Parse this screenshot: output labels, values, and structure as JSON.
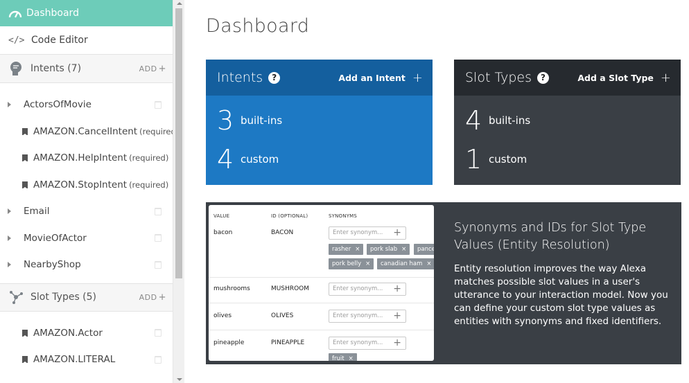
{
  "sidebar": {
    "dashboard_label": "Dashboard",
    "code_editor_label": "Code Editor",
    "intents_header": "Intents (7)",
    "intents_add": "ADD",
    "intents": [
      {
        "label": "ActorsOfMovie",
        "kind": "top"
      },
      {
        "label": "AMAZON.CancelIntent",
        "note": "(required)",
        "kind": "sub"
      },
      {
        "label": "AMAZON.HelpIntent",
        "note": "(required)",
        "kind": "sub"
      },
      {
        "label": "AMAZON.StopIntent",
        "note": "(required)",
        "kind": "sub"
      },
      {
        "label": "Email",
        "kind": "top"
      },
      {
        "label": "MovieOfActor",
        "kind": "top"
      },
      {
        "label": "NearbyShop",
        "kind": "top"
      }
    ],
    "slot_types_header": "Slot Types (5)",
    "slot_types_add": "ADD",
    "slot_types": [
      {
        "label": "AMAZON.Actor"
      },
      {
        "label": "AMAZON.LITERAL"
      }
    ]
  },
  "main": {
    "title": "Dashboard",
    "intents_card": {
      "title": "Intents",
      "action": "Add an Intent",
      "builtins_count": "3",
      "builtins_label": "built-ins",
      "custom_count": "4",
      "custom_label": "custom"
    },
    "slots_card": {
      "title": "Slot Types",
      "action": "Add a Slot Type",
      "builtins_count": "4",
      "builtins_label": "built-ins",
      "custom_count": "1",
      "custom_label": "custom"
    },
    "promo": {
      "title": "Synonyms and IDs for Slot Type Values (Entity Resolution)",
      "body": "Entity resolution improves the way Alexa matches possible slot values in a user's utterance to your interaction model. Now you can define your custom slot type values as entities with synonyms and fixed identifiers.",
      "table": {
        "headers": [
          "VALUE",
          "ID (OPTIONAL)",
          "SYNONYMS"
        ],
        "placeholder": "Enter synonym...",
        "rows": [
          {
            "value": "bacon",
            "id": "BACON",
            "synonyms": [
              "rasher",
              "pork slab",
              "pancet",
              "pork belly",
              "canadian ham"
            ]
          },
          {
            "value": "mushrooms",
            "id": "MUSHROOM",
            "synonyms": []
          },
          {
            "value": "olives",
            "id": "OLIVES",
            "synonyms": []
          },
          {
            "value": "pineapple",
            "id": "PINEAPPLE",
            "synonyms": [
              "fruit"
            ]
          }
        ]
      }
    }
  },
  "colors": {
    "sidebar_active": "#6dccb9",
    "intents_card": "#1d79c4",
    "intents_card_header": "#145f9e",
    "slots_card": "#3a3f45",
    "slots_card_header": "#262a2f"
  }
}
